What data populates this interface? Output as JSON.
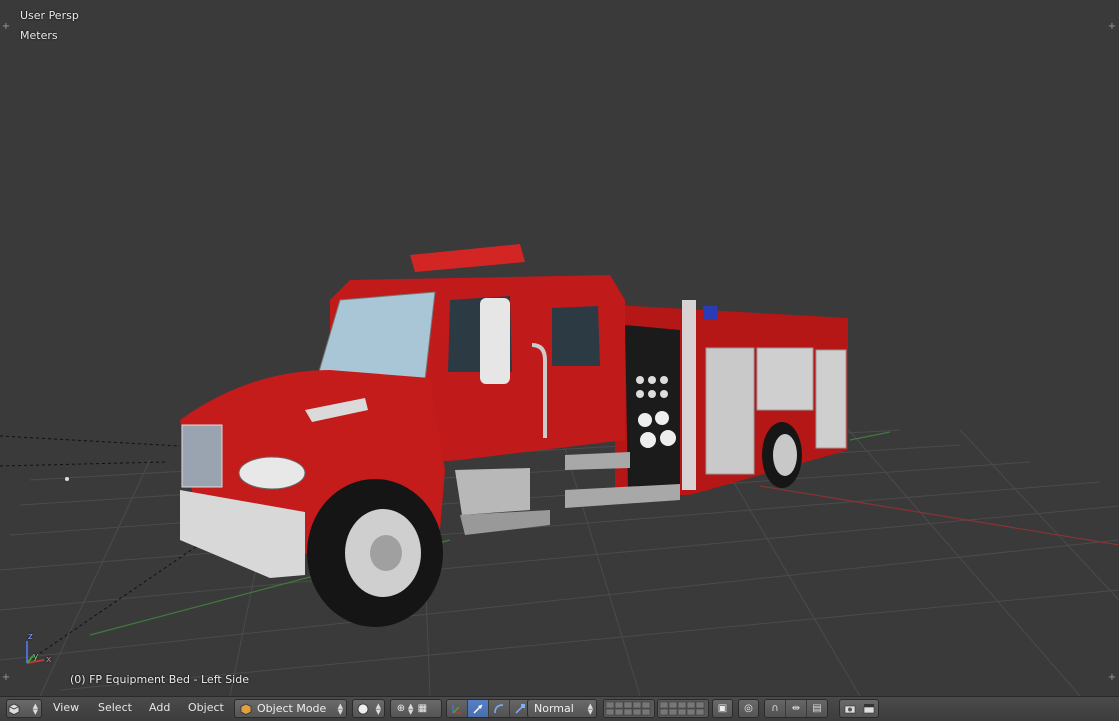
{
  "viewport": {
    "view_name": "User Persp",
    "units": "Meters",
    "object_info": "(0) FP Equipment Bed - Left Side",
    "axis_labels": {
      "z": "z",
      "y": "y",
      "x": "x"
    }
  },
  "header": {
    "menus": {
      "view": "View",
      "select": "Select",
      "add": "Add",
      "object": "Object"
    },
    "mode": "Object Mode",
    "transform_orientation": "Normal",
    "icons": {
      "editor_type": "cube-icon",
      "viewport_shading": "sphere-icon",
      "pivot": "pivot-icon",
      "manipulator": "manipulator-icon",
      "layers": "layers-icon",
      "proportional": "proportional-icon",
      "snap": "magnet-icon",
      "render": "camera-icon"
    }
  },
  "colors": {
    "viewport_bg": "#3a3a3a",
    "grid": "#4a4a4a",
    "x_axis": "#8a3333",
    "y_axis": "#3f7a3f",
    "truck_red": "#c01a1a",
    "header_bg": "#444444",
    "active_blue": "#5680c2"
  }
}
